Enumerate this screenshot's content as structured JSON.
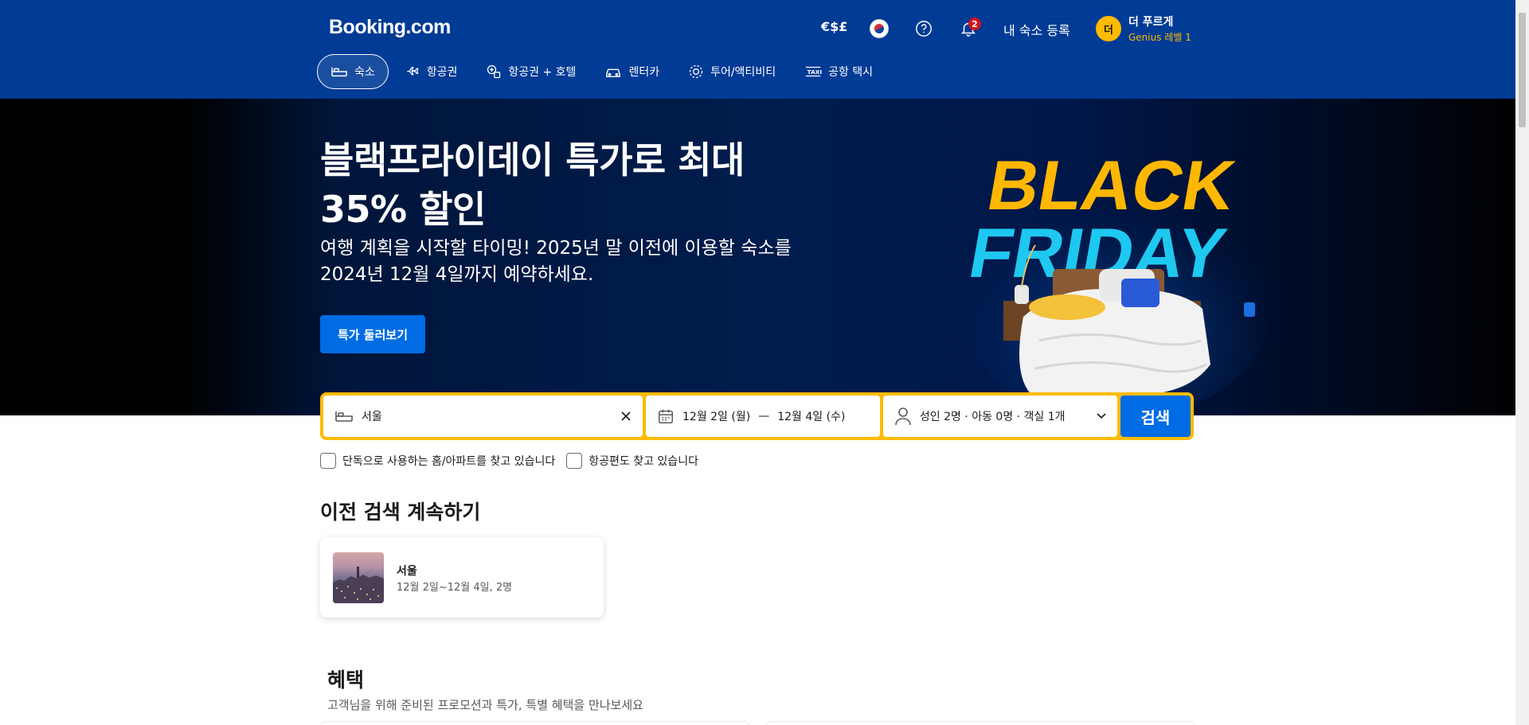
{
  "header": {
    "logo": "Booking.com",
    "currency": "€$£",
    "notifications_count": "2",
    "list_property": "내 숙소 등록",
    "user": {
      "initial": "더",
      "name": "더 푸르게",
      "level": "Genius 레벨 1"
    }
  },
  "nav": {
    "tabs": [
      {
        "label": "숙소",
        "icon": "bed-icon",
        "active": true
      },
      {
        "label": "항공권",
        "icon": "plane-icon"
      },
      {
        "label": "항공권 + 호텔",
        "icon": "plane-hotel-icon"
      },
      {
        "label": "렌터카",
        "icon": "car-icon"
      },
      {
        "label": "투어/액티비티",
        "icon": "attractions-icon"
      },
      {
        "label": "공항 택시",
        "icon": "taxi-icon"
      }
    ]
  },
  "hero": {
    "title": "블랙프라이데이 특가로 최대 35% 할인",
    "subtitle": "여행 계획을 시작할 타이밍! 2025년 말 이전에 이용할 숙소를 2024년 12월 4일까지 예약하세요.",
    "cta": "특가 둘러보기",
    "art_text_1": "BLACK",
    "art_text_2": "FRIDAY"
  },
  "search": {
    "destination": "서울",
    "checkin": "12월 2일 (월)",
    "separator": "—",
    "checkout": "12월 4일 (수)",
    "occupancy": "성인 2명 · 아동 0명 · 객실 1개",
    "button": "검색"
  },
  "filters": {
    "entire_homes": "단독으로 사용하는 홈/아파트를 찾고 있습니다",
    "flights": "항공편도 찾고 있습니다"
  },
  "recent": {
    "title": "이전 검색 계속하기",
    "items": [
      {
        "city": "서울",
        "meta": "12월 2일~12월 4일, 2명"
      }
    ]
  },
  "offers": {
    "title": "혜택",
    "subtitle": "고객님을 위해 준비된 프로모션과 특가, 특별 혜택을 만나보세요"
  },
  "colors": {
    "brand_blue": "#003b95",
    "action_blue": "#006ce4",
    "search_border": "#febb02",
    "bf_yellow": "#ffb700",
    "bf_cyan": "#1ec8f0"
  }
}
